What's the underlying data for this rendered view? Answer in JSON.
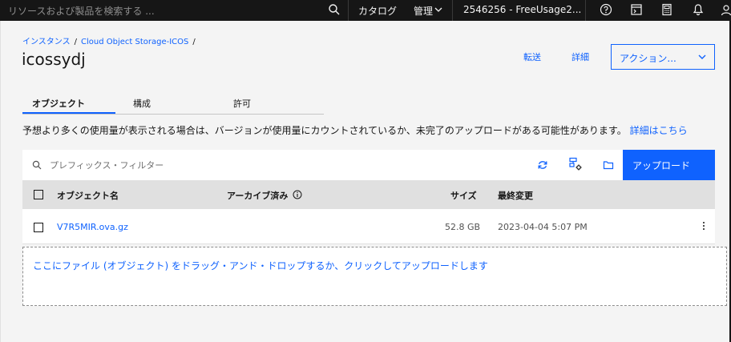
{
  "topbar": {
    "search_placeholder": "リソースおよび製品を検索する ...",
    "catalog": "カタログ",
    "manage": "管理",
    "account": "2546256 - FreeUsage2..."
  },
  "breadcrumb": {
    "items": [
      "インスタンス",
      "Cloud Object Storage-ICOS"
    ],
    "separator": "/"
  },
  "page": {
    "title": "icossydj",
    "transfer": "転送",
    "details": "詳細",
    "actions": "アクション..."
  },
  "tabs": [
    "オブジェクト",
    "構成",
    "許可"
  ],
  "info": {
    "text": "予想より多くの使用量が表示される場合は、バージョンが使用量にカウントされているか、未完了のアップロードがある可能性があります。",
    "link": "詳細はこちら"
  },
  "toolbar": {
    "filter_placeholder": "プレフィックス・フィルター",
    "upload": "アップロード"
  },
  "table": {
    "columns": {
      "name": "オブジェクト名",
      "archived": "アーカイブ済み",
      "size": "サイズ",
      "modified": "最終変更"
    },
    "rows": [
      {
        "name": "V7R5MIR.ova.gz",
        "archived": "",
        "size": "52.8 GB",
        "modified": "2023-04-04 5:07 PM"
      }
    ]
  },
  "dropzone": {
    "text": "ここにファイル (オブジェクト) をドラッグ・アンド・ドロップするか、クリックしてアップロードします"
  },
  "colors": {
    "accent": "#0f62fe",
    "topbar": "#161616",
    "background": "#f4f4f4"
  }
}
